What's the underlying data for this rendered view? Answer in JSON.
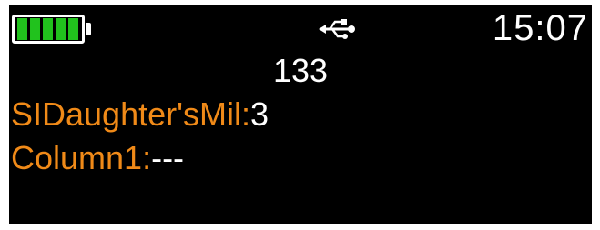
{
  "status": {
    "battery_level": 1.0,
    "battery_cells": 5,
    "battery_color": "#21c21d",
    "usb_icon": "usb-icon",
    "time": "15:07"
  },
  "main_value": "133",
  "fields": [
    {
      "label": "SIDaughter'sMil:",
      "value": "3"
    },
    {
      "label": "Column1:",
      "value": "---"
    }
  ],
  "colors": {
    "label": "#f08a18",
    "value": "#ffffff",
    "background": "#000000"
  }
}
